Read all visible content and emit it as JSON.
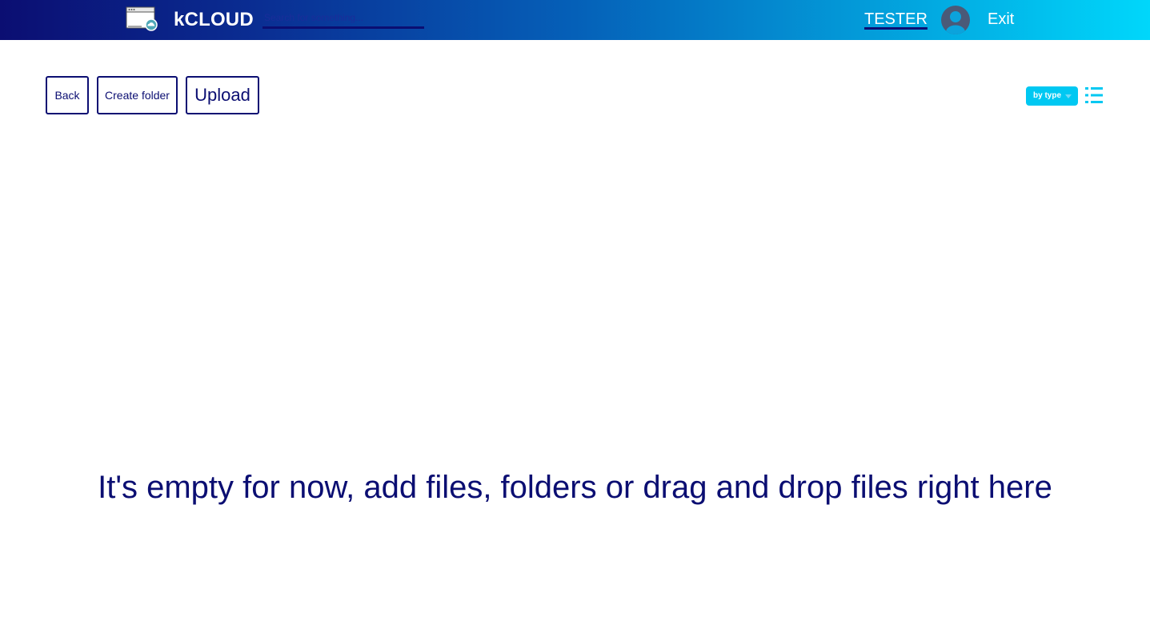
{
  "header": {
    "brand": "kCLOUD",
    "logo_icon": "browser-window-cloud-icon",
    "search": {
      "placeholder": "Search for something...",
      "value": ""
    },
    "username": "TESTER",
    "avatar_icon": "user-avatar-icon",
    "exit_label": "Exit"
  },
  "toolbar": {
    "back_label": "Back",
    "create_folder_label": "Create folder",
    "upload_label": "Upload",
    "sort_label": "by type",
    "view_toggle_icon": "list-view-icon"
  },
  "main": {
    "empty_message": "It's empty for now, add files, folders or drag and drop files right here"
  },
  "colors": {
    "primary_dark": "#0b0e72",
    "accent_cyan": "#00c8f2",
    "gradient_start": "#0b0e72",
    "gradient_end": "#00d7fb",
    "background": "#ffffff"
  }
}
